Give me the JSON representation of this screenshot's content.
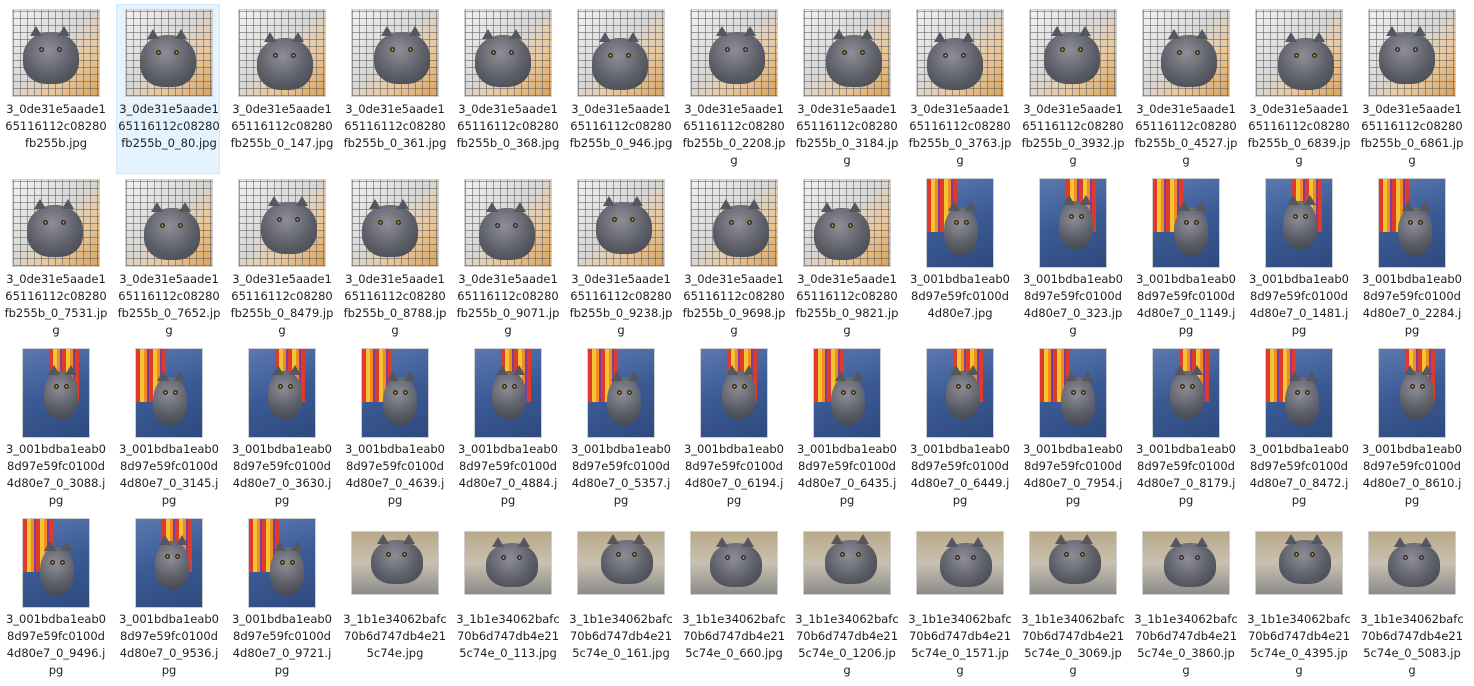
{
  "view": {
    "selected_index": 1
  },
  "files": [
    {
      "name": "3_0de31e5aade165116112c08280fb255b.jpg",
      "kind": "cage"
    },
    {
      "name": "3_0de31e5aade165116112c08280fb255b_0_80.jpg",
      "kind": "cage"
    },
    {
      "name": "3_0de31e5aade165116112c08280fb255b_0_147.jpg",
      "kind": "cage"
    },
    {
      "name": "3_0de31e5aade165116112c08280fb255b_0_361.jpg",
      "kind": "cage"
    },
    {
      "name": "3_0de31e5aade165116112c08280fb255b_0_368.jpg",
      "kind": "cage"
    },
    {
      "name": "3_0de31e5aade165116112c08280fb255b_0_946.jpg",
      "kind": "cage"
    },
    {
      "name": "3_0de31e5aade165116112c08280fb255b_0_2208.jpg",
      "kind": "cage"
    },
    {
      "name": "3_0de31e5aade165116112c08280fb255b_0_3184.jpg",
      "kind": "cage"
    },
    {
      "name": "3_0de31e5aade165116112c08280fb255b_0_3763.jpg",
      "kind": "cage"
    },
    {
      "name": "3_0de31e5aade165116112c08280fb255b_0_3932.jpg",
      "kind": "cage"
    },
    {
      "name": "3_0de31e5aade165116112c08280fb255b_0_4527.jpg",
      "kind": "cage"
    },
    {
      "name": "3_0de31e5aade165116112c08280fb255b_0_6839.jpg",
      "kind": "cage"
    },
    {
      "name": "3_0de31e5aade165116112c08280fb255b_0_6861.jpg",
      "kind": "cage"
    },
    {
      "name": "3_0de31e5aade165116112c08280fb255b_0_7531.jpg",
      "kind": "cage"
    },
    {
      "name": "3_0de31e5aade165116112c08280fb255b_0_7652.jpg",
      "kind": "cage"
    },
    {
      "name": "3_0de31e5aade165116112c08280fb255b_0_8479.jpg",
      "kind": "cage"
    },
    {
      "name": "3_0de31e5aade165116112c08280fb255b_0_8788.jpg",
      "kind": "cage"
    },
    {
      "name": "3_0de31e5aade165116112c08280fb255b_0_9071.jpg",
      "kind": "cage"
    },
    {
      "name": "3_0de31e5aade165116112c08280fb255b_0_9238.jpg",
      "kind": "cage"
    },
    {
      "name": "3_0de31e5aade165116112c08280fb255b_0_9698.jpg",
      "kind": "cage"
    },
    {
      "name": "3_0de31e5aade165116112c08280fb255b_0_9821.jpg",
      "kind": "cage"
    },
    {
      "name": "3_001bdba1eab08d97e59fc0100d4d80e7.jpg",
      "kind": "sofa"
    },
    {
      "name": "3_001bdba1eab08d97e59fc0100d4d80e7_0_323.jpg",
      "kind": "sofa"
    },
    {
      "name": "3_001bdba1eab08d97e59fc0100d4d80e7_0_1149.jpg",
      "kind": "sofa"
    },
    {
      "name": "3_001bdba1eab08d97e59fc0100d4d80e7_0_1481.jpg",
      "kind": "sofa"
    },
    {
      "name": "3_001bdba1eab08d97e59fc0100d4d80e7_0_2284.jpg",
      "kind": "sofa"
    },
    {
      "name": "3_001bdba1eab08d97e59fc0100d4d80e7_0_3088.jpg",
      "kind": "sofa"
    },
    {
      "name": "3_001bdba1eab08d97e59fc0100d4d80e7_0_3145.jpg",
      "kind": "sofa"
    },
    {
      "name": "3_001bdba1eab08d97e59fc0100d4d80e7_0_3630.jpg",
      "kind": "sofa"
    },
    {
      "name": "3_001bdba1eab08d97e59fc0100d4d80e7_0_4639.jpg",
      "kind": "sofa"
    },
    {
      "name": "3_001bdba1eab08d97e59fc0100d4d80e7_0_4884.jpg",
      "kind": "sofa"
    },
    {
      "name": "3_001bdba1eab08d97e59fc0100d4d80e7_0_5357.jpg",
      "kind": "sofa"
    },
    {
      "name": "3_001bdba1eab08d97e59fc0100d4d80e7_0_6194.jpg",
      "kind": "sofa"
    },
    {
      "name": "3_001bdba1eab08d97e59fc0100d4d80e7_0_6435.jpg",
      "kind": "sofa"
    },
    {
      "name": "3_001bdba1eab08d97e59fc0100d4d80e7_0_6449.jpg",
      "kind": "sofa"
    },
    {
      "name": "3_001bdba1eab08d97e59fc0100d4d80e7_0_7954.jpg",
      "kind": "sofa"
    },
    {
      "name": "3_001bdba1eab08d97e59fc0100d4d80e7_0_8179.jpg",
      "kind": "sofa"
    },
    {
      "name": "3_001bdba1eab08d97e59fc0100d4d80e7_0_8472.jpg",
      "kind": "sofa"
    },
    {
      "name": "3_001bdba1eab08d97e59fc0100d4d80e7_0_8610.jpg",
      "kind": "sofa"
    },
    {
      "name": "3_001bdba1eab08d97e59fc0100d4d80e7_0_9496.jpg",
      "kind": "sofa"
    },
    {
      "name": "3_001bdba1eab08d97e59fc0100d4d80e7_0_9536.jpg",
      "kind": "sofa"
    },
    {
      "name": "3_001bdba1eab08d97e59fc0100d4d80e7_0_9721.jpg",
      "kind": "sofa"
    },
    {
      "name": "3_1b1e34062bafc70b6d747db4e215c74e.jpg",
      "kind": "portrait"
    },
    {
      "name": "3_1b1e34062bafc70b6d747db4e215c74e_0_113.jpg",
      "kind": "portrait"
    },
    {
      "name": "3_1b1e34062bafc70b6d747db4e215c74e_0_161.jpg",
      "kind": "portrait"
    },
    {
      "name": "3_1b1e34062bafc70b6d747db4e215c74e_0_660.jpg",
      "kind": "portrait"
    },
    {
      "name": "3_1b1e34062bafc70b6d747db4e215c74e_0_1206.jpg",
      "kind": "portrait"
    },
    {
      "name": "3_1b1e34062bafc70b6d747db4e215c74e_0_1571.jpg",
      "kind": "portrait"
    },
    {
      "name": "3_1b1e34062bafc70b6d747db4e215c74e_0_3069.jpg",
      "kind": "portrait"
    },
    {
      "name": "3_1b1e34062bafc70b6d747db4e215c74e_0_3860.jpg",
      "kind": "portrait"
    },
    {
      "name": "3_1b1e34062bafc70b6d747db4e215c74e_0_4395.jpg",
      "kind": "portrait"
    },
    {
      "name": "3_1b1e34062bafc70b6d747db4e215c74e_0_5083.jpg",
      "kind": "portrait"
    }
  ]
}
